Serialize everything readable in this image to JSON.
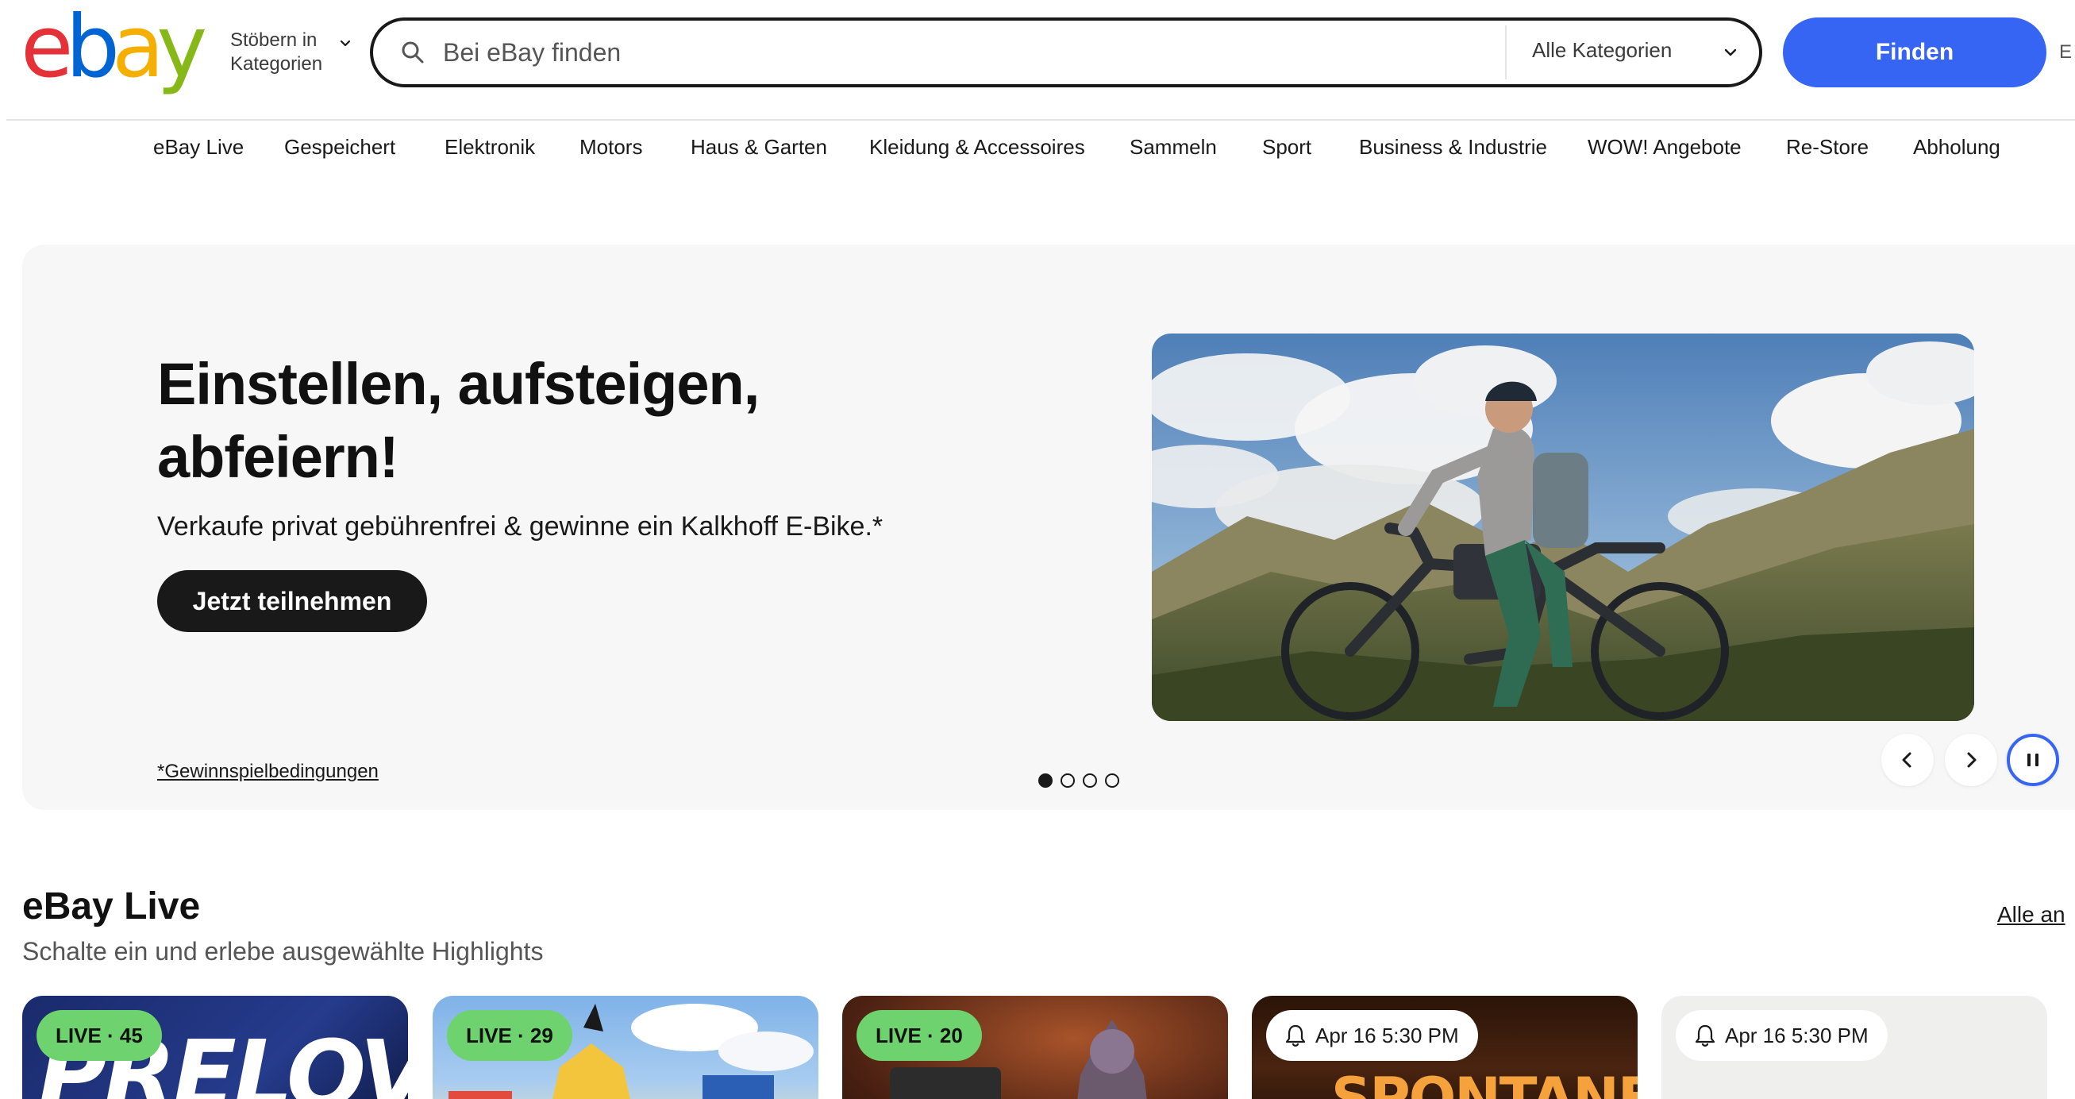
{
  "header": {
    "logo_letters": [
      "e",
      "b",
      "a",
      "y"
    ],
    "browse_line1": "Stöbern in",
    "browse_line2": "Kategorien",
    "search_placeholder": "Bei eBay finden",
    "category_select": "Alle Kategorien",
    "find_button": "Finden",
    "advanced_truncated": "E"
  },
  "nav": [
    "eBay Live",
    "Gespeichert",
    "Elektronik",
    "Motors",
    "Haus & Garten",
    "Kleidung & Accessoires",
    "Sammeln",
    "Sport",
    "Business & Industrie",
    "WOW! Angebote",
    "Re-Store",
    "Abholung"
  ],
  "hero": {
    "title_line1": "Einstellen, aufsteigen,",
    "title_line2": "abfeiern!",
    "subtitle": "Verkaufe privat gebührenfrei & gewinne ein Kalkhoff E-Bike.*",
    "cta": "Jetzt teilnehmen",
    "terms_link": "*Gewinnspielbedingungen",
    "slide_count": 4,
    "active_slide": 1
  },
  "live": {
    "title": "eBay Live",
    "subtitle": "Schalte ein und erlebe ausgewählte Highlights",
    "see_all": "Alle an",
    "cards": [
      {
        "badge": "LIVE · 45",
        "type": "live",
        "art_text": "PRELOVED"
      },
      {
        "badge": "LIVE · 29",
        "type": "live",
        "art_text": ""
      },
      {
        "badge": "LIVE · 20",
        "type": "live",
        "art_text": ""
      },
      {
        "badge": "Apr 16 5:30 PM",
        "type": "scheduled",
        "art_text": "SPONTANER"
      },
      {
        "badge": "Apr 16 5:30 PM",
        "type": "scheduled",
        "art_text": ""
      }
    ]
  },
  "colors": {
    "brand_blue": "#3665f3",
    "logo_red": "#e53238",
    "logo_blue": "#0064d2",
    "logo_yellow": "#f5af02",
    "logo_green": "#86b817",
    "live_green": "#6ed36e"
  },
  "icons": [
    "search-icon",
    "chevron-down-icon",
    "chevron-left-icon",
    "chevron-right-icon",
    "pause-icon",
    "bell-icon"
  ]
}
